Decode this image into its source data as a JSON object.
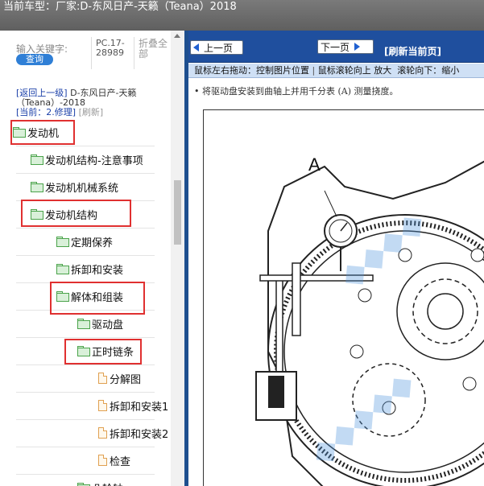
{
  "window": {
    "title": "当前车型：厂家:D-东风日产-天籁（Teana）2018"
  },
  "search": {
    "keyword_label": "输入关键字:",
    "query_button": "查询",
    "pc_code": "PC.17-28989",
    "fold_all": "折叠全部"
  },
  "nav": {
    "back": "[返回上一级]",
    "current_path": "D-东风日产-天籁（Teana）-2018",
    "current_label": "[当前：2.修理]",
    "refresh": "[刷新]"
  },
  "tree": [
    {
      "label": "发动机",
      "type": "folder",
      "highlighted": true
    },
    {
      "label": "发动机结构-注意事项",
      "type": "folder",
      "highlighted": false
    },
    {
      "label": "发动机机械系统",
      "type": "folder",
      "highlighted": false
    },
    {
      "label": "发动机结构",
      "type": "folder",
      "highlighted": true
    },
    {
      "label": "定期保养",
      "type": "folder",
      "highlighted": false
    },
    {
      "label": "拆卸和安装",
      "type": "folder",
      "highlighted": false
    },
    {
      "label": "解体和组装",
      "type": "folder",
      "highlighted": true
    },
    {
      "label": "驱动盘",
      "type": "folder",
      "highlighted": false
    },
    {
      "label": "正时链条",
      "type": "folder",
      "highlighted": true
    },
    {
      "label": "分解图",
      "type": "doc",
      "highlighted": false
    },
    {
      "label": "拆卸和安装1",
      "type": "doc",
      "highlighted": false
    },
    {
      "label": "拆卸和安装2",
      "type": "doc",
      "highlighted": false
    },
    {
      "label": "检查",
      "type": "doc",
      "highlighted": false
    },
    {
      "label": "凸轮轴",
      "type": "folder",
      "highlighted": false
    }
  ],
  "toolbar": {
    "prev_label": "上一页",
    "next_label": "下一页",
    "refresh_current": "[刷新当前页]"
  },
  "hints": {
    "drag": "鼠标左右拖动：控制图片位置",
    "wheel_up": "鼠标滚轮向上 放大",
    "wheel_down": "滚轮向下：缩小"
  },
  "content": {
    "instruction": "将驱动盘安装到曲轴上并用千分表 (A) 测量挠度。",
    "figure_label": "A"
  },
  "colors": {
    "toolbar_bg": "#1f4f9e",
    "highlight_border": "#e03030",
    "hint_bg": "#cfe0f5"
  }
}
